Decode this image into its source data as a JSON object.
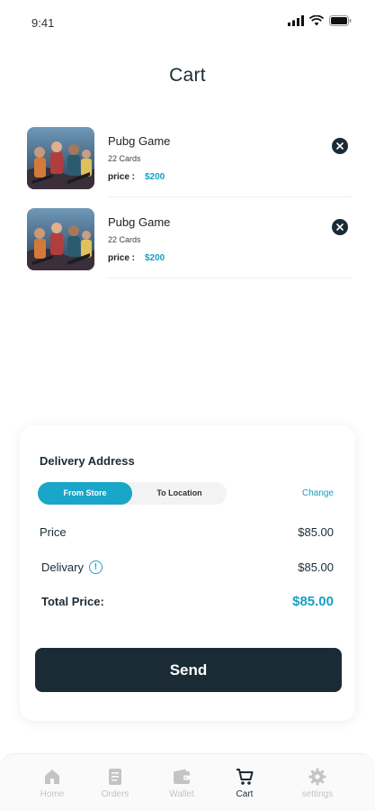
{
  "status_bar": {
    "time": "9:41"
  },
  "page": {
    "title": "Cart"
  },
  "cart": {
    "price_label": "price :",
    "items": [
      {
        "name": "Pubg Game",
        "count": "22 Cards",
        "price": "$200"
      },
      {
        "name": "Pubg Game",
        "count": "22 Cards",
        "price": "$200"
      }
    ]
  },
  "summary": {
    "address_title": "Delivery Address",
    "toggle": {
      "from_store": "From Store",
      "to_location": "To Location",
      "selected": "From Store"
    },
    "change_label": "Change",
    "price_label": "Price",
    "price_value": "$85.00",
    "delivery_label": "Delivary",
    "delivery_value": "$85.00",
    "total_label": "Total Price:",
    "total_value": "$85.00",
    "send_label": "Send"
  },
  "nav": {
    "items": [
      {
        "label": "Home",
        "icon": "home-icon"
      },
      {
        "label": "Orders",
        "icon": "orders-icon"
      },
      {
        "label": "Wallet",
        "icon": "wallet-icon"
      },
      {
        "label": "Cart",
        "icon": "cart-icon",
        "active": true
      },
      {
        "label": "settings",
        "icon": "gear-icon"
      }
    ]
  },
  "colors": {
    "accent": "#1aa6c9",
    "dark": "#1b2b36",
    "inactive": "#c4c4c4"
  }
}
